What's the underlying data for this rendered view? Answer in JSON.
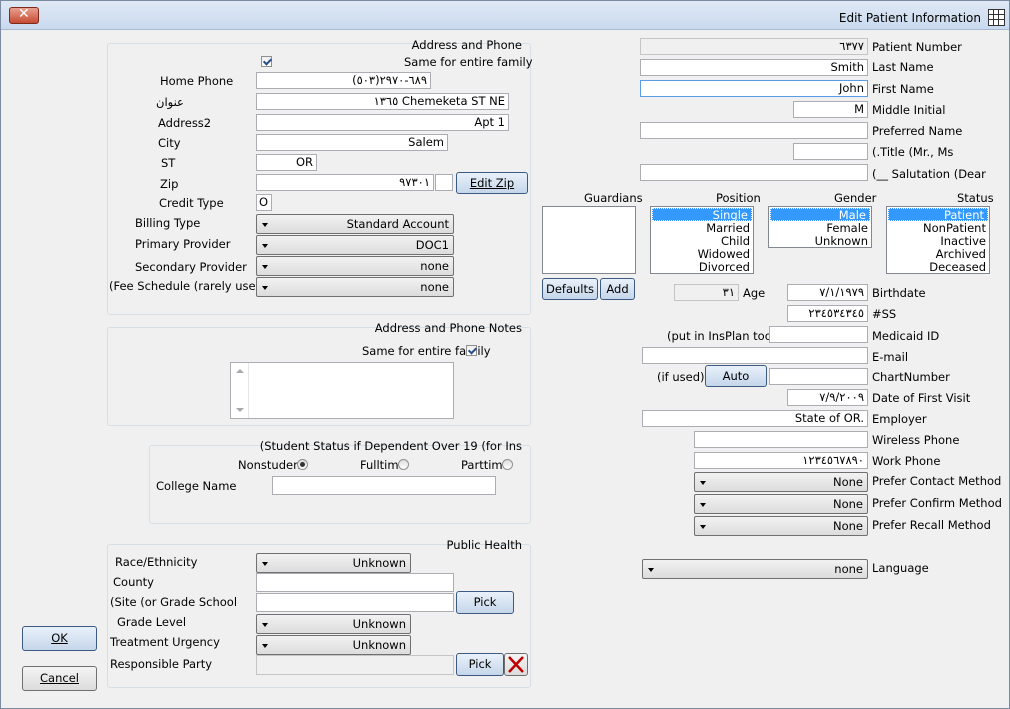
{
  "window": {
    "title": "Edit Patient Information"
  },
  "address_phone": {
    "group_label": "Address and Phone",
    "same_family_label": "Same for entire family",
    "home_phone_label": "Home Phone",
    "home_phone": "(٥٠٣)٦٨٩-٢٩٧٠",
    "address_label": "عنوان",
    "address": "١٣٦٥ Chemeketa ST NE",
    "address2_label": "Address2",
    "address2": "Apt 1",
    "city_label": "City",
    "city": "Salem",
    "st_label": "ST",
    "st": "OR",
    "zip_label": "Zip",
    "zip": "٩٧٣٠١",
    "edit_zip": "Edit Zip",
    "credit_type_label": "Credit Type",
    "credit_type": "O",
    "billing_type_label": "Billing Type",
    "billing_type": "Standard Account",
    "primary_provider_label": "Primary Provider",
    "primary_provider": "DOC1",
    "secondary_provider_label": "Secondary Provider",
    "secondary_provider": "none",
    "fee_schedule_label": "(Fee Schedule (rarely used",
    "fee_schedule": "none"
  },
  "notes": {
    "group_label": "Address and Phone Notes",
    "same_family_label": "Same for entire family"
  },
  "student": {
    "group_label": "(Student Status if Dependent Over 19 (for Ins",
    "nonstudent": "Nonstudent",
    "fulltime": "Fulltime",
    "parttime": "Parttime",
    "college_label": "College Name"
  },
  "public_health": {
    "group_label": "Public Health",
    "race_label": "Race/Ethnicity",
    "race": "Unknown",
    "county_label": "County",
    "site_label": "(Site (or Grade School",
    "pick": "Pick",
    "grade_label": "Grade Level",
    "grade": "Unknown",
    "urgency_label": "Treatment Urgency",
    "urgency": "Unknown",
    "responsible_label": "Responsible Party",
    "pick2": "Pick"
  },
  "buttons": {
    "ok": "OK",
    "cancel": "Cancel"
  },
  "patient": {
    "patient_number_label": "Patient Number",
    "patient_number": "٦٣٧٧",
    "last_name_label": "Last Name",
    "last_name": "Smith",
    "first_name_label": "First Name",
    "first_name": "John",
    "middle_label": "Middle Initial",
    "middle": "M",
    "preferred_label": "Preferred Name",
    "title_label": "(.Title (Mr., Ms",
    "salutation_label": "(__ Salutation (Dear"
  },
  "lists": {
    "guardians_label": "Guardians",
    "defaults": "Defaults",
    "add": "Add",
    "position_label": "Position",
    "position": [
      "Single",
      "Married",
      "Child",
      "Widowed",
      "Divorced"
    ],
    "gender_label": "Gender",
    "gender": [
      "Male",
      "Female",
      "Unknown"
    ],
    "status_label": "Status",
    "status": [
      "Patient",
      "NonPatient",
      "Inactive",
      "Archived",
      "Deceased"
    ]
  },
  "details": {
    "age_label": "Age",
    "age": "٣١",
    "birthdate_label": "Birthdate",
    "birthdate": "٧/١/١٩٧٩",
    "ss_label": "#SS",
    "ss": "٢٣٤٥٣٤٣٤٥",
    "medicaid_hint": "(put in InsPlan too)",
    "medicaid_label": "Medicaid ID",
    "email_label": "E-mail",
    "if_used": "(if used)",
    "auto": "Auto",
    "chart_label": "ChartNumber",
    "first_visit_label": "Date of First Visit",
    "first_visit": "٧/٩/٢٠٠٩",
    "employer_label": "Employer",
    "employer": "State of OR.",
    "wireless_label": "Wireless Phone",
    "work_label": "Work Phone",
    "work": "١٢٣٤٥٦٧٨٩٠",
    "contact_label": "Prefer Contact Method",
    "contact": "None",
    "confirm_label": "Prefer Confirm Method",
    "confirm": "None",
    "recall_label": "Prefer Recall Method",
    "recall": "None",
    "language_label": "Language",
    "language": "none"
  }
}
